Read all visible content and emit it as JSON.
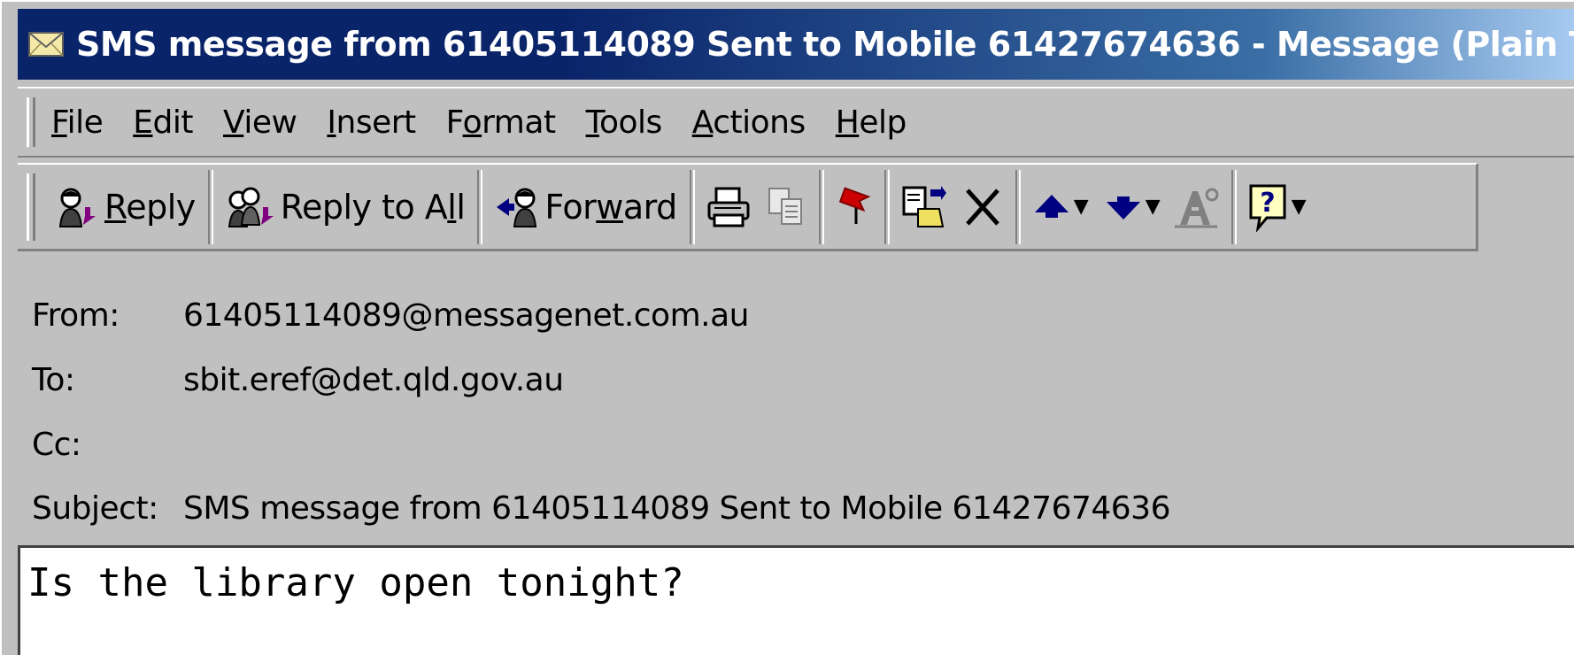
{
  "window": {
    "title": "SMS message from  61405114089 Sent to Mobile 61427674636 - Message (Plain Text)",
    "title_icon": "envelope-icon",
    "colors": {
      "titlebar_start": "#0a246a",
      "titlebar_end": "#a6caf0",
      "chrome": "#c0c0c0"
    }
  },
  "menu": {
    "items": [
      {
        "accel": "F",
        "rest": "ile"
      },
      {
        "accel": "E",
        "rest": "dit"
      },
      {
        "accel": "V",
        "rest": "iew"
      },
      {
        "accel": "I",
        "rest": "nsert"
      },
      {
        "pre": "F",
        "accel": "o",
        "rest": "rmat"
      },
      {
        "accel": "T",
        "rest": "ools"
      },
      {
        "accel": "A",
        "rest": "ctions"
      },
      {
        "accel": "H",
        "rest": "elp"
      }
    ]
  },
  "toolbar": {
    "reply": {
      "accel": "R",
      "rest": "eply",
      "icon": "reply-icon"
    },
    "reply_all": {
      "pre": "Reply to A",
      "accel": "l",
      "rest": "l",
      "icon": "reply-all-icon"
    },
    "forward": {
      "pre": "For",
      "accel": "w",
      "rest": "ard",
      "icon": "forward-icon"
    },
    "icons": [
      "print-icon",
      "copy-icon",
      "flag-icon",
      "move-to-folder-icon",
      "delete-icon",
      "previous-item-icon",
      "next-item-icon",
      "address-book-icon",
      "help-icon"
    ]
  },
  "header": {
    "from_label": "From:",
    "from_value": "61405114089@messagenet.com.au",
    "to_label": "To:",
    "to_value": "sbit.eref@det.qld.gov.au",
    "cc_label": "Cc:",
    "cc_value": "",
    "subject_label": "Subject:",
    "subject_value": "SMS message from  61405114089 Sent to Mobile 61427674636"
  },
  "body": {
    "text": "Is the library open tonight?"
  }
}
